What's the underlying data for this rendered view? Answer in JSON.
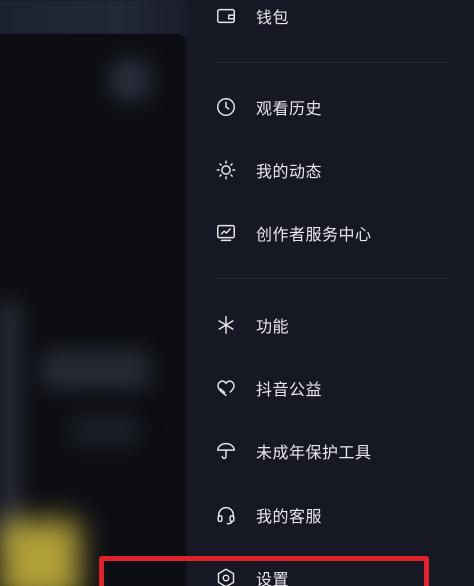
{
  "menu": {
    "items": [
      {
        "id": "wallet",
        "label": "钱包",
        "icon": "wallet-icon"
      },
      {
        "id": "history",
        "label": "观看历史",
        "icon": "clock-icon"
      },
      {
        "id": "activity",
        "label": "我的动态",
        "icon": "sun-icon"
      },
      {
        "id": "creator",
        "label": "创作者服务中心",
        "icon": "chart-monitor-icon"
      },
      {
        "id": "features",
        "label": "功能",
        "icon": "sparkle-icon"
      },
      {
        "id": "charity",
        "label": "抖音公益",
        "icon": "heart-icon"
      },
      {
        "id": "minor",
        "label": "未成年保护工具",
        "icon": "umbrella-icon"
      },
      {
        "id": "service",
        "label": "我的客服",
        "icon": "headset-icon"
      },
      {
        "id": "settings",
        "label": "设置",
        "icon": "hexagon-gear-icon"
      }
    ]
  },
  "colors": {
    "drawer_bg": "#161823",
    "text": "#e8e8ec",
    "highlight": "#e0232a"
  }
}
